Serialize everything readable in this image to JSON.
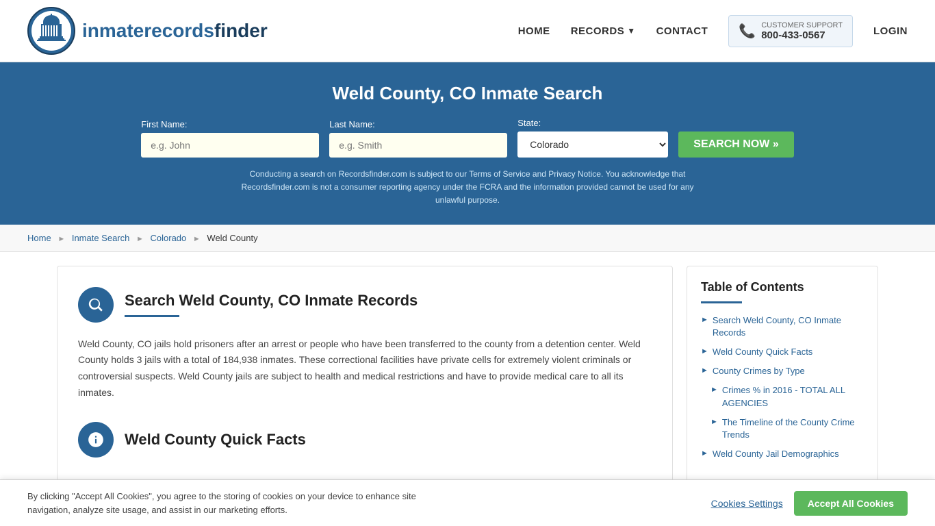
{
  "header": {
    "logo_text_light": "inmaterecords",
    "logo_text_bold": "finder",
    "nav": {
      "home": "HOME",
      "records": "RECORDS",
      "contact": "CONTACT",
      "login": "LOGIN"
    },
    "support": {
      "label": "CUSTOMER SUPPORT",
      "number": "800-433-0567"
    }
  },
  "banner": {
    "title": "Weld County, CO Inmate Search",
    "form": {
      "first_name_label": "First Name:",
      "first_name_placeholder": "e.g. John",
      "last_name_label": "Last Name:",
      "last_name_placeholder": "e.g. Smith",
      "state_label": "State:",
      "state_value": "Colorado",
      "search_button": "SEARCH NOW »"
    },
    "disclaimer": "Conducting a search on Recordsfinder.com is subject to our Terms of Service and Privacy Notice. You acknowledge that Recordsfinder.com is not a consumer reporting agency under the FCRA and the information provided cannot be used for any unlawful purpose."
  },
  "breadcrumb": {
    "home": "Home",
    "inmate_search": "Inmate Search",
    "colorado": "Colorado",
    "weld_county": "Weld County"
  },
  "main": {
    "section1": {
      "title": "Search Weld County, CO Inmate Records",
      "body": "Weld County, CO jails hold prisoners after an arrest or people who have been transferred to the county from a detention center. Weld County holds 3 jails with a total of 184,938 inmates. These correctional facilities have private cells for extremely violent criminals or controversial suspects. Weld County jails are subject to health and medical restrictions and have to provide medical care to all its inmates."
    },
    "section2": {
      "title": "Weld County Quick Facts"
    }
  },
  "sidebar": {
    "toc_title": "Table of Contents",
    "items": [
      {
        "label": "Search Weld County, CO Inmate Records",
        "sub": false
      },
      {
        "label": "Weld County Quick Facts",
        "sub": false
      },
      {
        "label": "County Crimes by Type",
        "sub": false
      },
      {
        "label": "Crimes % in 2016 - TOTAL ALL AGENCIES",
        "sub": true
      },
      {
        "label": "The Timeline of the County Crime Trends",
        "sub": true
      },
      {
        "label": "Weld County Jail Demographics",
        "sub": false
      }
    ]
  },
  "cookie_banner": {
    "text": "By clicking \"Accept All Cookies\", you agree to the storing of cookies on your device to enhance site navigation, analyze site usage, and assist in our marketing efforts.",
    "settings_label": "Cookies Settings",
    "accept_label": "Accept All Cookies"
  }
}
